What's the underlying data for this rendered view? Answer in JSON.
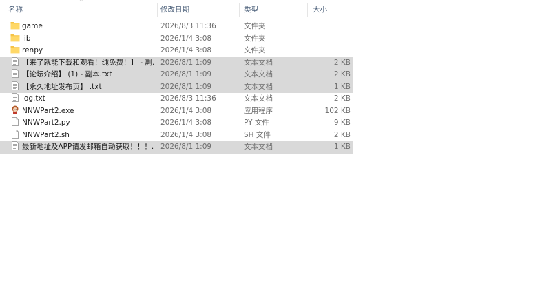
{
  "columns": {
    "name": "名称",
    "date": "修改日期",
    "type": "类型",
    "size": "大小"
  },
  "files": [
    {
      "name": "game",
      "date": "2026/8/3 11:36",
      "type": "文件夹",
      "size": "",
      "icon": "folder-icon",
      "selected": false
    },
    {
      "name": "lib",
      "date": "2026/1/4 3:08",
      "type": "文件夹",
      "size": "",
      "icon": "folder-icon",
      "selected": false
    },
    {
      "name": "renpy",
      "date": "2026/1/4 3:08",
      "type": "文件夹",
      "size": "",
      "icon": "folder-icon",
      "selected": false
    },
    {
      "name": "【来了就能下载和观看！纯免费！】 - 副...",
      "date": "2026/8/1 1:09",
      "type": "文本文档",
      "size": "2 KB",
      "icon": "text-file-icon",
      "selected": true
    },
    {
      "name": "【论坛介绍】 (1) - 副本.txt",
      "date": "2026/8/1 1:09",
      "type": "文本文档",
      "size": "2 KB",
      "icon": "text-file-icon",
      "selected": true
    },
    {
      "name": "【永久地址发布页】 .txt",
      "date": "2026/8/1 1:09",
      "type": "文本文档",
      "size": "1 KB",
      "icon": "text-file-icon",
      "selected": true
    },
    {
      "name": "log.txt",
      "date": "2026/8/3 11:36",
      "type": "文本文档",
      "size": "2 KB",
      "icon": "text-file-icon",
      "selected": false
    },
    {
      "name": "NNWPart2.exe",
      "date": "2026/1/4 3:08",
      "type": "应用程序",
      "size": "102 KB",
      "icon": "app-icon",
      "selected": false
    },
    {
      "name": "NNWPart2.py",
      "date": "2026/1/4 3:08",
      "type": "PY 文件",
      "size": "9 KB",
      "icon": "blank-file-icon",
      "selected": false
    },
    {
      "name": "NNWPart2.sh",
      "date": "2026/1/4 3:08",
      "type": "SH 文件",
      "size": "2 KB",
      "icon": "blank-file-icon",
      "selected": false
    },
    {
      "name": "最新地址及APP请发邮箱自动获取！！！...",
      "date": "2026/8/1 1:09",
      "type": "文本文档",
      "size": "1 KB",
      "icon": "text-file-icon",
      "selected": true
    }
  ]
}
